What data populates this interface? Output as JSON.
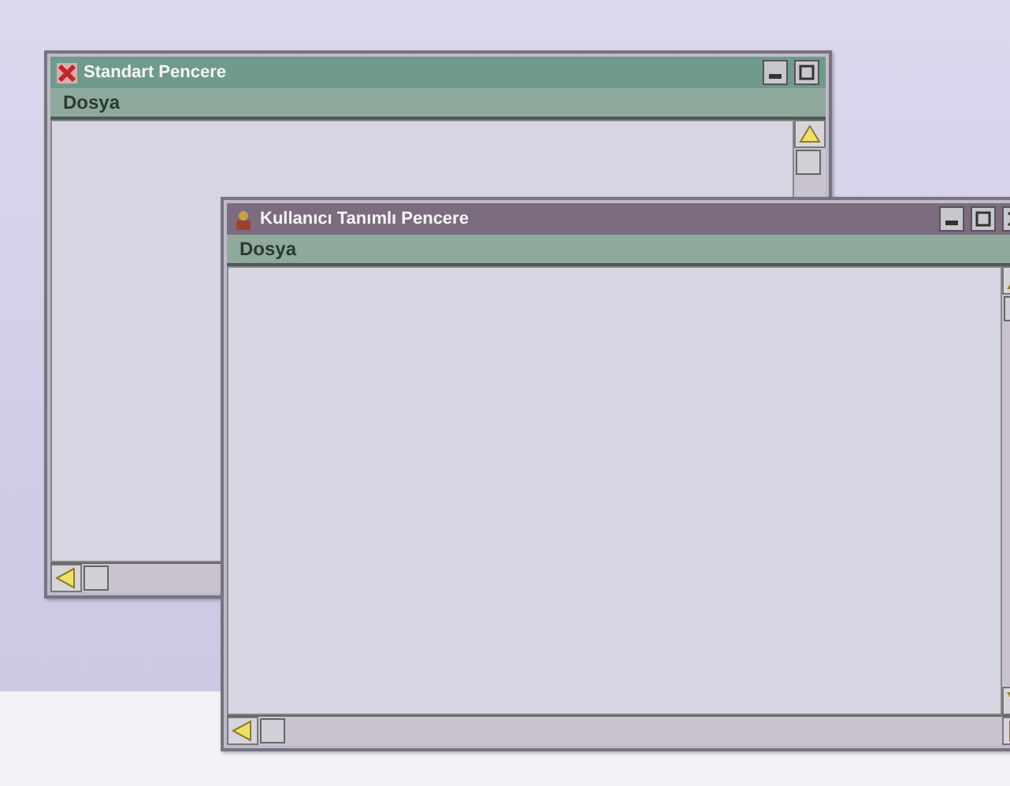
{
  "windows": [
    {
      "kind": "standard",
      "title": "Standart Pencere",
      "menu": [
        "Dosya"
      ]
    },
    {
      "kind": "custom",
      "title": "Kullanıcı Tanımlı Pencere",
      "menu": [
        "Dosya"
      ]
    }
  ]
}
